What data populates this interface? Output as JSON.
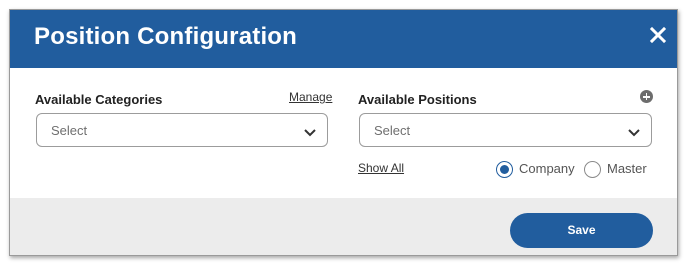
{
  "dialog": {
    "title": "Position Configuration",
    "close_icon": "close-icon"
  },
  "categories": {
    "label": "Available Categories",
    "manage_link": "Manage",
    "select_value": "Select"
  },
  "positions": {
    "label": "Available Positions",
    "add_icon": "plus-circle-icon",
    "select_value": "Select",
    "show_all_link": "Show All",
    "radio_options": [
      {
        "label": "Company",
        "selected": true
      },
      {
        "label": "Master",
        "selected": false
      }
    ]
  },
  "footer": {
    "save_label": "Save"
  },
  "colors": {
    "accent": "#215d9e",
    "footer_bg": "#ececec"
  }
}
